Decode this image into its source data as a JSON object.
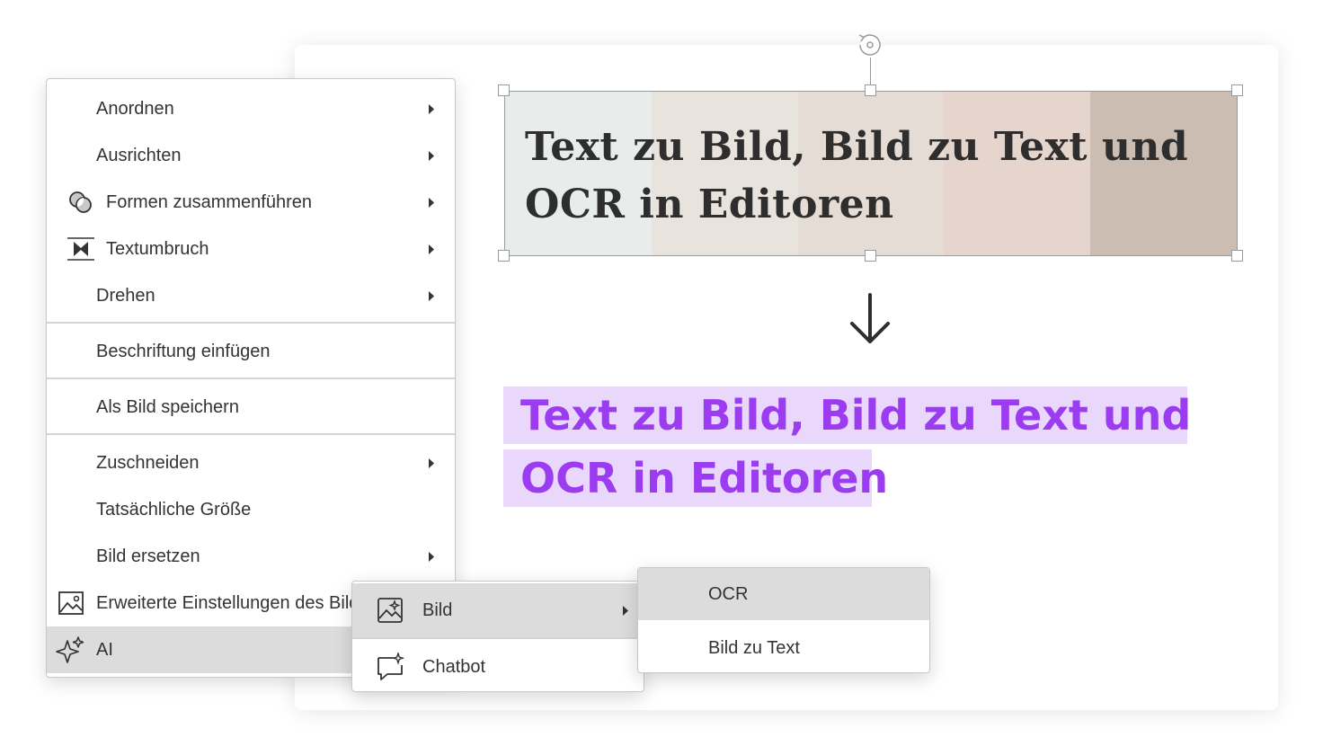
{
  "context_menu": {
    "items": [
      {
        "label": "Anordnen"
      },
      {
        "label": "Ausrichten"
      },
      {
        "label": "Formen zusammenführen"
      },
      {
        "label": "Textumbruch"
      },
      {
        "label": "Drehen"
      },
      {
        "label": "Beschriftung einfügen"
      },
      {
        "label": "Als Bild speichern"
      },
      {
        "label": "Zuschneiden"
      },
      {
        "label": "Tatsächliche Größe"
      },
      {
        "label": "Bild ersetzen"
      },
      {
        "label": "Erweiterte Einstellungen des Bildes"
      },
      {
        "label": "AI"
      }
    ]
  },
  "ai_submenu": {
    "items": [
      {
        "label": "Bild"
      },
      {
        "label": "Chatbot"
      }
    ]
  },
  "bild_submenu": {
    "items": [
      {
        "label": "OCR"
      },
      {
        "label": "Bild zu Text"
      }
    ]
  },
  "canvas": {
    "image_text_line1": "Text zu Bild, Bild zu Text und",
    "image_text_line2": "OCR in Editoren",
    "ocr_text_line1": "Text zu Bild, Bild zu Text und",
    "ocr_text_line2": "OCR in Editoren"
  },
  "colors": {
    "image_swatches": [
      "#e8edec",
      "#e9e3de",
      "#e5ddd5",
      "#e6d5cc",
      "#cbbdb1"
    ],
    "ocr_highlight": "#e9d8fb",
    "ocr_text": "#9b3cf0",
    "menu_highlight": "#dcdcdc"
  }
}
